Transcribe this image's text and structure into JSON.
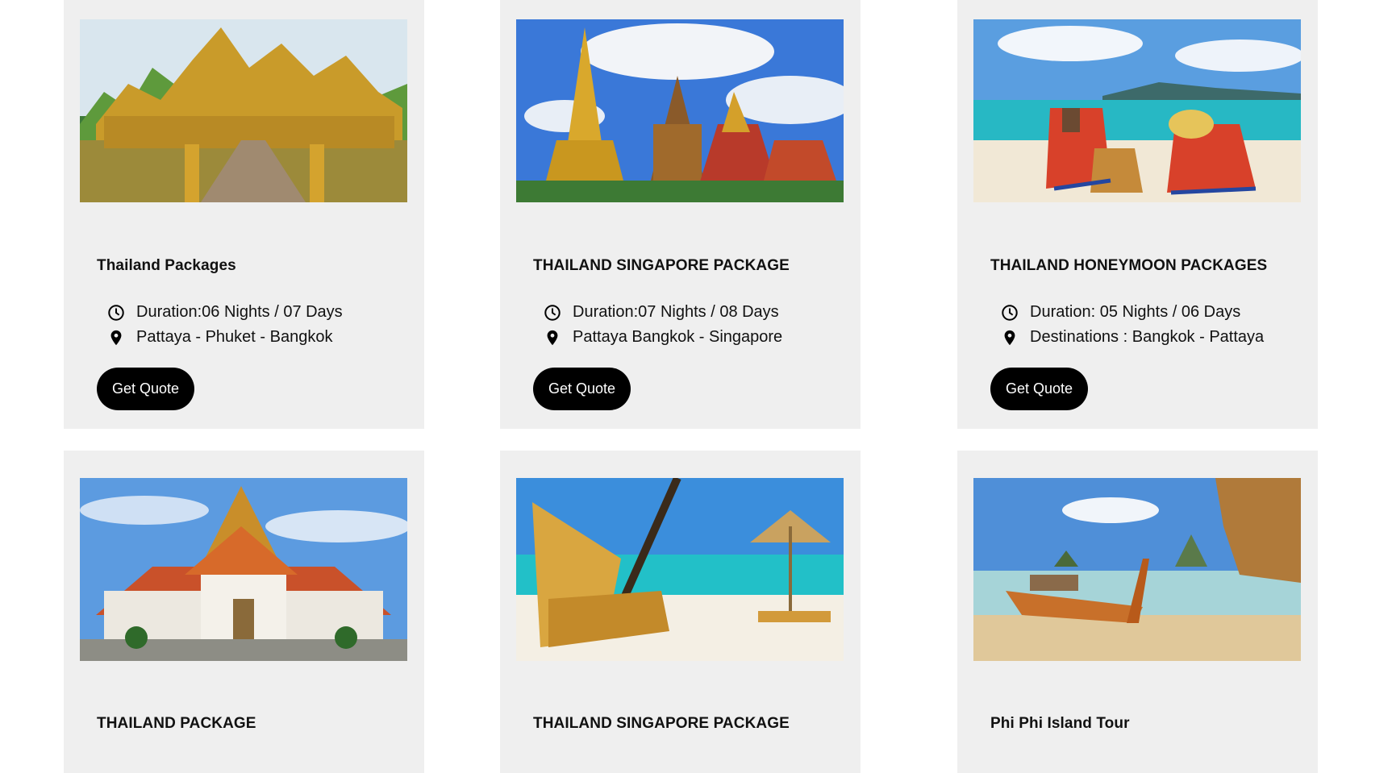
{
  "cards": [
    {
      "title": "Thailand Packages",
      "duration": "Duration:06 Nights / 07 Days",
      "destinations": "Pattaya - Phuket - Bangkok",
      "button": "Get Quote",
      "image": "golden-temple-on-water"
    },
    {
      "title": "THAILAND SINGAPORE PACKAGE",
      "duration": "Duration:07 Nights / 08 Days",
      "destinations": "Pattaya Bangkok - Singapore",
      "button": "Get Quote",
      "image": "grand-palace-stupas"
    },
    {
      "title": "THAILAND HONEYMOON PACKAGES",
      "duration": "Duration: 05 Nights / 06 Days",
      "destinations": "Destinations : Bangkok - Pattaya",
      "button": "Get Quote",
      "image": "couple-beach-chairs"
    },
    {
      "title": "THAILAND PACKAGE",
      "image": "marble-temple"
    },
    {
      "title": "THAILAND SINGAPORE PACKAGE",
      "image": "beach-chair-umbrella"
    },
    {
      "title": "Phi Phi Island Tour",
      "image": "longtail-boat-island"
    }
  ],
  "icons": {
    "duration": "clock-icon",
    "location": "map-pin-icon"
  }
}
